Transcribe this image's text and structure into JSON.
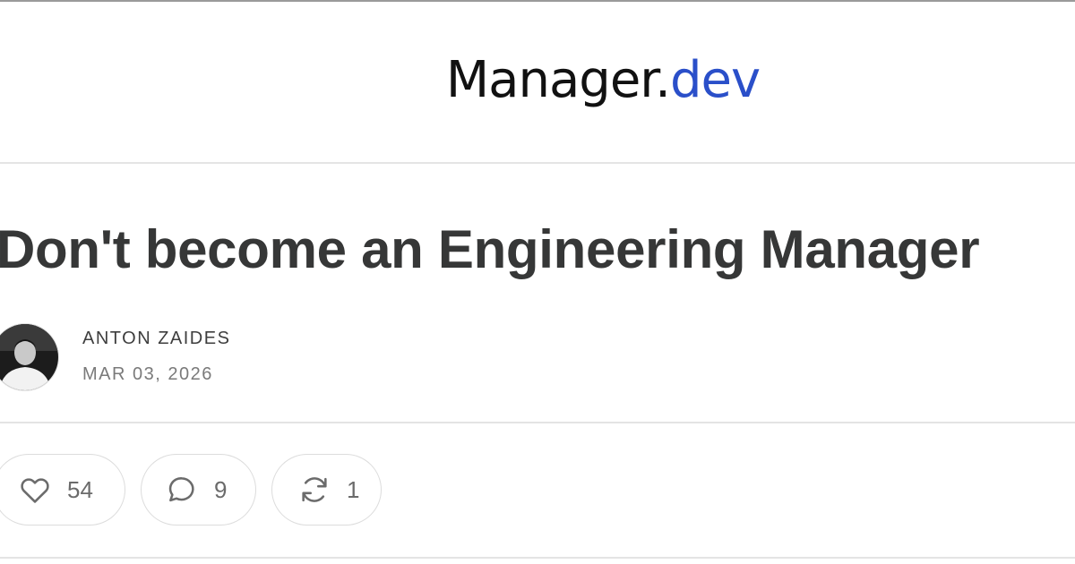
{
  "publication": {
    "name_main": "Manager.",
    "name_accent": "dev",
    "accent_color": "#2a4fc9"
  },
  "post": {
    "title": "Don't become an Engineering Manager",
    "author": "ANTON ZAIDES",
    "date": "MAR 03, 2026"
  },
  "actions": {
    "like": {
      "icon": "heart-icon",
      "count": "54"
    },
    "comment": {
      "icon": "speech-bubble-icon",
      "count": "9"
    },
    "restack": {
      "icon": "refresh-arrows-icon",
      "count": "1"
    }
  }
}
